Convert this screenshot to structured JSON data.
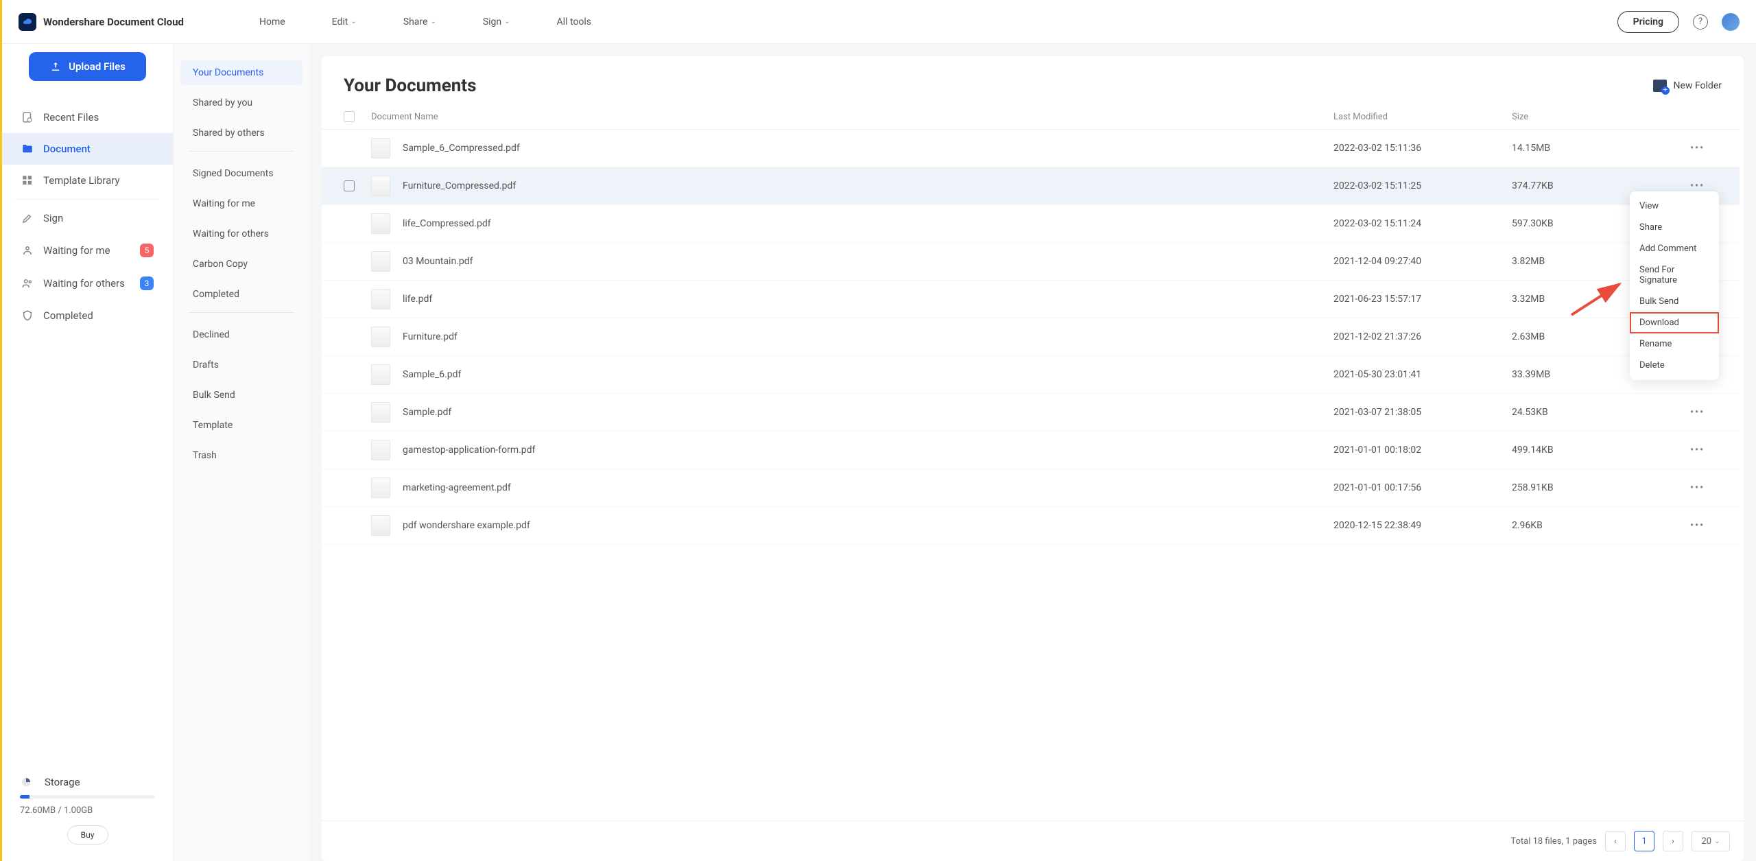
{
  "brand": "Wondershare Document Cloud",
  "topnav": {
    "home": "Home",
    "edit": "Edit",
    "share": "Share",
    "sign": "Sign",
    "all_tools": "All tools"
  },
  "topbar": {
    "pricing": "Pricing"
  },
  "upload_btn": "Upload Files",
  "sidebarL": {
    "recent": "Recent Files",
    "document": "Document",
    "template": "Template Library",
    "sign": "Sign",
    "waiting_me": "Waiting for me",
    "waiting_me_badge": "5",
    "waiting_others": "Waiting for others",
    "waiting_others_badge": "3",
    "completed": "Completed"
  },
  "storage": {
    "label": "Storage",
    "text": "72.60MB / 1.00GB",
    "buy": "Buy"
  },
  "sidebarM": {
    "your_docs": "Your Documents",
    "shared_by_you": "Shared by you",
    "shared_by_others": "Shared by others",
    "signed": "Signed Documents",
    "waiting_me": "Waiting for me",
    "waiting_others": "Waiting for others",
    "carbon": "Carbon Copy",
    "completed": "Completed",
    "declined": "Declined",
    "drafts": "Drafts",
    "bulk": "Bulk Send",
    "template": "Template",
    "trash": "Trash"
  },
  "panel": {
    "title": "Your Documents",
    "new_folder": "New Folder"
  },
  "table": {
    "headers": {
      "name": "Document Name",
      "modified": "Last Modified",
      "size": "Size"
    },
    "rows": [
      {
        "name": "Sample_6_Compressed.pdf",
        "date": "2022-03-02 15:11:36",
        "size": "14.15MB"
      },
      {
        "name": "Furniture_Compressed.pdf",
        "date": "2022-03-02 15:11:25",
        "size": "374.77KB"
      },
      {
        "name": "life_Compressed.pdf",
        "date": "2022-03-02 15:11:24",
        "size": "597.30KB"
      },
      {
        "name": "03 Mountain.pdf",
        "date": "2021-12-04 09:27:40",
        "size": "3.82MB"
      },
      {
        "name": "life.pdf",
        "date": "2021-06-23 15:57:17",
        "size": "3.32MB"
      },
      {
        "name": "Furniture.pdf",
        "date": "2021-12-02 21:37:26",
        "size": "2.63MB"
      },
      {
        "name": "Sample_6.pdf",
        "date": "2021-05-30 23:01:41",
        "size": "33.39MB"
      },
      {
        "name": "Sample.pdf",
        "date": "2021-03-07 21:38:05",
        "size": "24.53KB"
      },
      {
        "name": "gamestop-application-form.pdf",
        "date": "2021-01-01 00:18:02",
        "size": "499.14KB"
      },
      {
        "name": "marketing-agreement.pdf",
        "date": "2021-01-01 00:17:56",
        "size": "258.91KB"
      },
      {
        "name": "pdf wondershare example.pdf",
        "date": "2020-12-15 22:38:49",
        "size": "2.96KB"
      }
    ]
  },
  "ctx": {
    "view": "View",
    "share": "Share",
    "comment": "Add Comment",
    "sign": "Send For Signature",
    "bulk": "Bulk Send",
    "download": "Download",
    "rename": "Rename",
    "delete": "Delete"
  },
  "footer": {
    "total": "Total 18 files, 1 pages",
    "page": "1",
    "per": "20"
  }
}
